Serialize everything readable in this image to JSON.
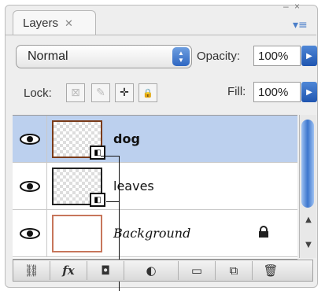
{
  "window": {
    "minimize_glyph": "–",
    "close_glyph": "×"
  },
  "panel": {
    "tab_label": "Layers",
    "tab_close_glyph": "✕",
    "menu_glyph": "▾≡"
  },
  "blend": {
    "mode": "Normal",
    "arrows_up": "▲",
    "arrows_down": "▼"
  },
  "opacity": {
    "label": "Opacity:",
    "value": "100%",
    "go_glyph": "▶"
  },
  "lock": {
    "label": "Lock:",
    "buttons": [
      {
        "icon": "transparent-pixels-lock-icon",
        "glyph": "⊠"
      },
      {
        "icon": "brush-lock-icon",
        "glyph": "✎"
      },
      {
        "icon": "move-lock-icon",
        "glyph": "✛"
      },
      {
        "icon": "padlock-icon",
        "glyph": "🔒"
      }
    ]
  },
  "fill": {
    "label": "Fill:",
    "value": "100%",
    "go_glyph": "▶"
  },
  "layers": [
    {
      "name": "dog",
      "selected": true,
      "visible": true,
      "smart_object": true
    },
    {
      "name": "leaves",
      "selected": false,
      "visible": true,
      "smart_object": true
    },
    {
      "name": "Background",
      "selected": false,
      "visible": true,
      "locked": true
    }
  ],
  "bottom_buttons": [
    {
      "icon": "link-layers-icon",
      "glyph": "⛓"
    },
    {
      "icon": "layer-style-fx-icon",
      "glyph": "fx"
    },
    {
      "icon": "layer-mask-icon",
      "glyph": "◘"
    },
    {
      "icon": "adjustment-layer-icon",
      "glyph": "◐"
    },
    {
      "icon": "new-group-folder-icon",
      "glyph": "▭"
    },
    {
      "icon": "new-layer-icon",
      "glyph": "⧉"
    },
    {
      "icon": "trash-icon",
      "glyph": "🗑"
    }
  ],
  "scrollbar": {
    "up_glyph": "▲",
    "down_glyph": "▼"
  },
  "colors": {
    "selected_row": "#bcd0ee",
    "accent_blue": "#3b75cd",
    "thumb_border_selected": "#7a3b19"
  }
}
